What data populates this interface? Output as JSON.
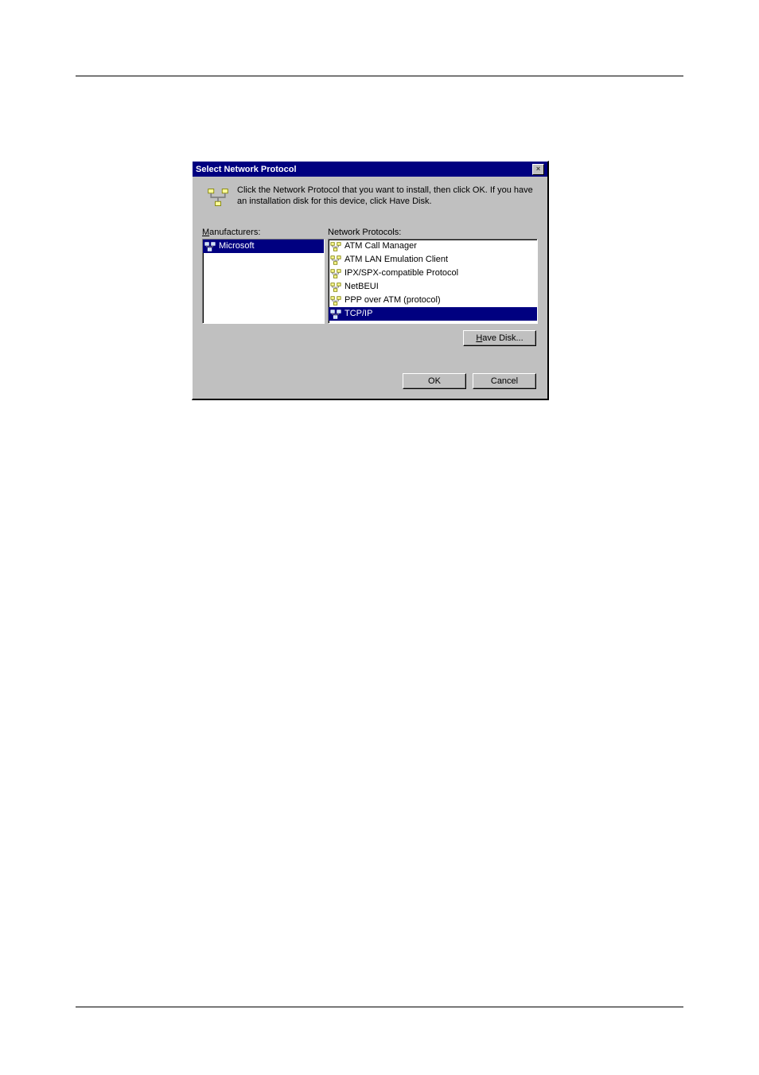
{
  "dialog": {
    "title": "Select Network Protocol",
    "close_glyph": "×",
    "instruction": "Click the Network Protocol that you want to install, then click OK. If you have an installation disk for this device, click Have Disk.",
    "manufacturers_label_pre": "M",
    "manufacturers_label_post": "anufacturers:",
    "protocols_label": "Network Protocols:",
    "manufacturers": [
      {
        "name": "Microsoft",
        "selected": true
      }
    ],
    "protocols": [
      {
        "name": "ATM Call Manager",
        "selected": false
      },
      {
        "name": "ATM LAN Emulation Client",
        "selected": false
      },
      {
        "name": "IPX/SPX-compatible Protocol",
        "selected": false
      },
      {
        "name": "NetBEUI",
        "selected": false
      },
      {
        "name": "PPP over ATM (protocol)",
        "selected": false
      },
      {
        "name": "TCP/IP",
        "selected": true
      }
    ],
    "have_disk_pre": "H",
    "have_disk_post": "ave Disk...",
    "ok_label": "OK",
    "cancel_label": "Cancel"
  }
}
